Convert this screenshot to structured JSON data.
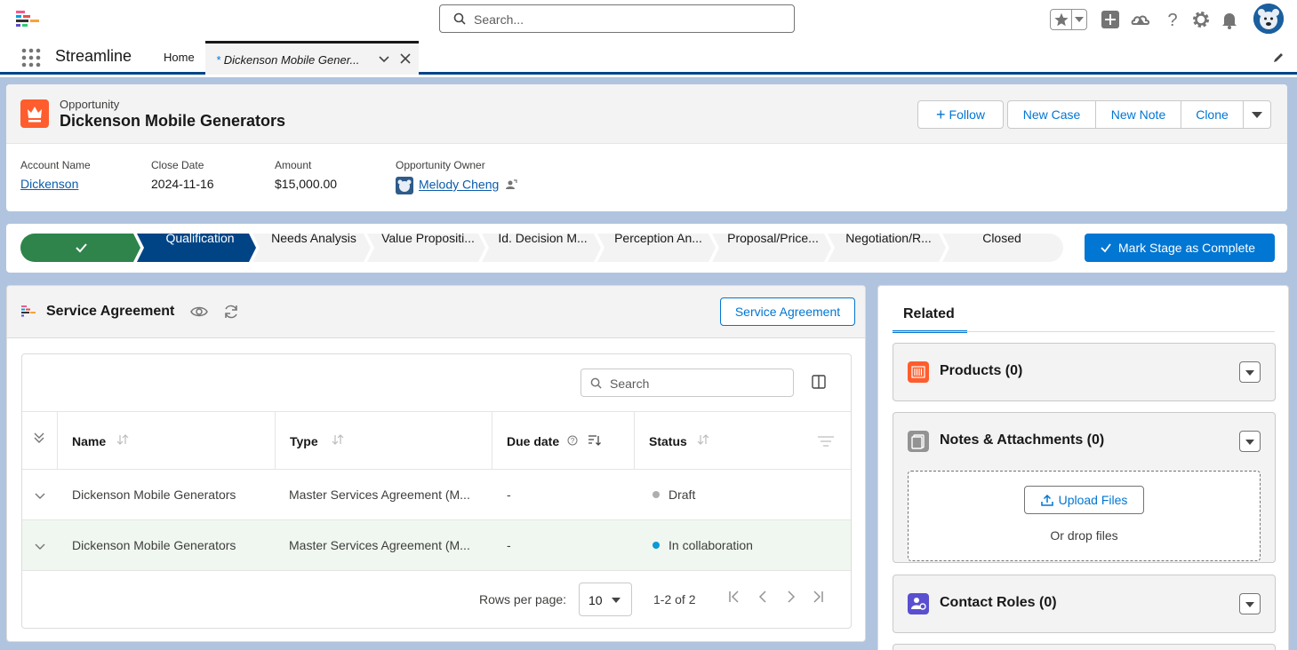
{
  "global_header": {
    "search_placeholder": "Search...",
    "icons": [
      "favorites-star-icon",
      "favorites-dropdown-icon",
      "global-add-icon",
      "trailhead-icon",
      "help-icon",
      "setup-gear-icon",
      "notifications-bell-icon",
      "user-avatar"
    ]
  },
  "nav": {
    "app_name": "Streamline",
    "home_tab": "Home",
    "active_tab_star": "*",
    "active_tab": "Dickenson Mobile Gener..."
  },
  "record": {
    "object_type": "Opportunity",
    "title": "Dickenson Mobile Generators",
    "actions": {
      "follow": "Follow",
      "new_case": "New Case",
      "new_note": "New Note",
      "clone": "Clone"
    },
    "fields": {
      "account_name_label": "Account Name",
      "account_name": "Dickenson",
      "close_date_label": "Close Date",
      "close_date": "2024-11-16",
      "amount_label": "Amount",
      "amount": "$15,000.00",
      "owner_label": "Opportunity Owner",
      "owner": "Melody Cheng"
    }
  },
  "path": {
    "stages": [
      "Qualification",
      "Needs Analysis",
      "Value Propositi...",
      "Id. Decision M...",
      "Perception An...",
      "Proposal/Price...",
      "Negotiation/R...",
      "Closed"
    ],
    "current_stage": "Qualification",
    "mark_complete": "Mark Stage as Complete",
    "colors": {
      "complete": "#2e844a",
      "current": "#014486",
      "incomplete": "#f3f3f3"
    }
  },
  "service_agreement": {
    "title": "Service Agreement",
    "button": "Service Agreement",
    "search_placeholder": "Search",
    "columns": {
      "name": "Name",
      "type": "Type",
      "due_date": "Due date",
      "status": "Status"
    },
    "rows": [
      {
        "name": "Dickenson Mobile Generators",
        "type": "Master Services Agreement (M...",
        "due": "-",
        "status": "Draft",
        "status_color": "#aeaeae"
      },
      {
        "name": "Dickenson Mobile Generators",
        "type": "Master Services Agreement (M...",
        "due": "-",
        "status": "In collaboration",
        "status_color": "#0b9ad6"
      }
    ],
    "pager": {
      "rows_per_page_label": "Rows per page:",
      "rows_per_page": "10",
      "range": "1-2 of 2"
    }
  },
  "related": {
    "tab": "Related",
    "products": "Products (0)",
    "notes": "Notes & Attachments (0)",
    "upload": "Upload Files",
    "drop": "Or drop files",
    "contact_roles": "Contact Roles (0)"
  }
}
